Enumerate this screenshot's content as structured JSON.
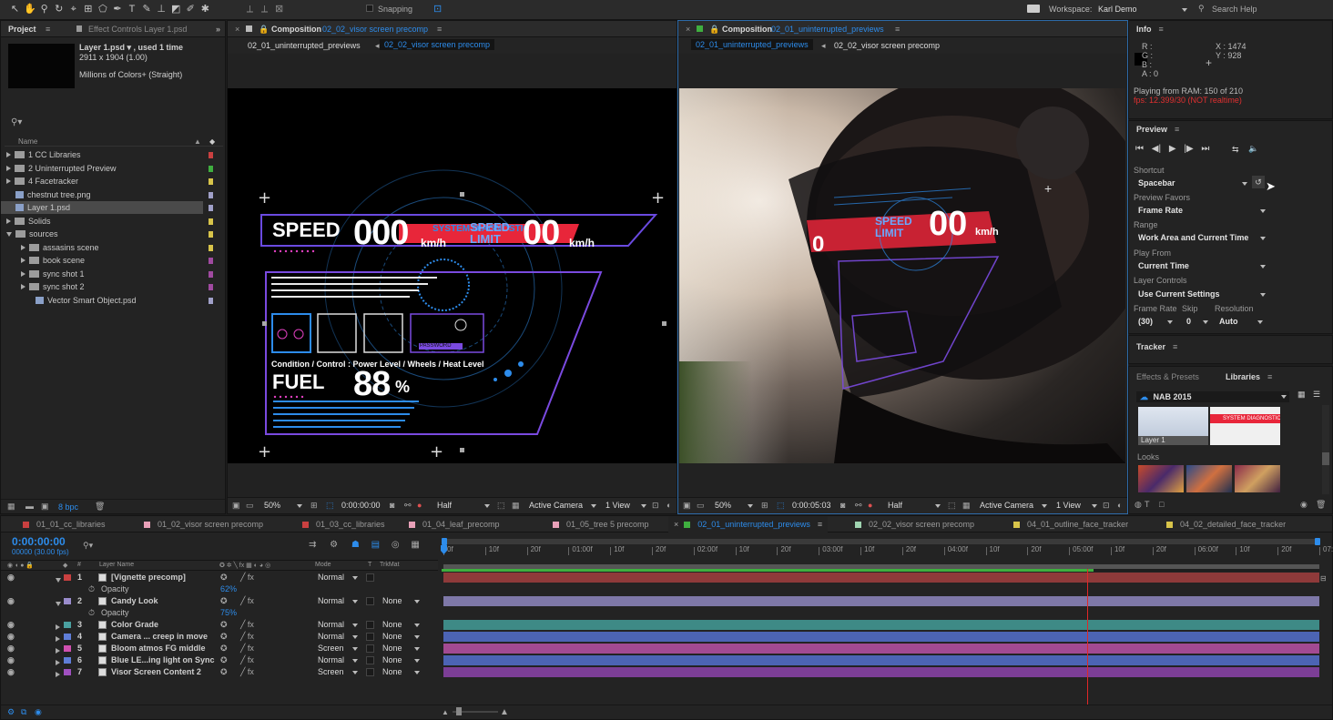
{
  "toolbar": {
    "snapping": "Snapping",
    "workspace_label": "Workspace:",
    "workspace": "Karl Demo",
    "search": "Search Help"
  },
  "project": {
    "title": "Project",
    "effects_tab": "Effect Controls Layer 1.psd",
    "file_name": "Layer 1.psd ▾ , used 1 time",
    "dims": "2911 x 1904 (1.00)",
    "colors": "Millions of Colors+ (Straight)",
    "name_col": "Name",
    "bpc": "8 bpc",
    "items": [
      {
        "name": "1 CC Libraries",
        "type": "folder",
        "color": "#c94040"
      },
      {
        "name": "2 Uninterrupted Preview",
        "type": "folder",
        "color": "#3fae3f"
      },
      {
        "name": "4 Facetracker",
        "type": "folder",
        "color": "#d8c44a"
      },
      {
        "name": "chestnut tree.png",
        "type": "file",
        "color": "#a0a0c8"
      },
      {
        "name": "Layer 1.psd",
        "type": "file",
        "color": "#a0a0c8"
      },
      {
        "name": "Solids",
        "type": "folder",
        "color": "#d8c44a"
      },
      {
        "name": "sources",
        "type": "folder-open",
        "color": "#d8c44a"
      },
      {
        "name": "assasins scene",
        "type": "subfolder",
        "color": "#d8c44a"
      },
      {
        "name": "book scene",
        "type": "subfolder",
        "color": "#a04aa0"
      },
      {
        "name": "sync shot 1",
        "type": "subfolder",
        "color": "#a04aa0"
      },
      {
        "name": "sync shot 2",
        "type": "subfolder",
        "color": "#a04aa0"
      },
      {
        "name": "Vector Smart Object.psd",
        "type": "file2",
        "color": "#a0a0c8"
      }
    ]
  },
  "comp1": {
    "title": "Composition",
    "name": "02_02_visor screen precomp",
    "bc1": "02_01_uninterrupted_previews",
    "bc2": "02_02_visor screen precomp",
    "zoom": "50%",
    "time": "0:00:00:00",
    "res": "Half",
    "camera": "Active Camera",
    "view": "1 View"
  },
  "comp2": {
    "title": "Composition",
    "name": "02_01_uninterrupted_previews",
    "bc1": "02_01_uninterrupted_previews",
    "bc2": "02_02_visor screen precomp",
    "zoom": "50%",
    "time": "0:00:05:03",
    "res": "Half",
    "camera": "Active Camera",
    "view": "1 View"
  },
  "hud": {
    "speed": "SPEED",
    "speed_val": "000",
    "kmh": "km/h",
    "limit": "SPEED\nLIMIT",
    "limit_val": "00",
    "cond": "Condition / Control : Power Level / Wheels / Heat Level",
    "fuel": "FUEL",
    "fuel_val": "88",
    "pct": "%",
    "diag": "SYSTEM DIAGNOSTIC",
    "pw": "PASSWORD"
  },
  "visor": {
    "limit": "SPEED LIMIT",
    "val": "00",
    "kmh": "km/h",
    "left": "0",
    "sub": "0 km/h"
  },
  "info": {
    "title": "Info",
    "r": "R :",
    "g": "G :",
    "b": "B :",
    "a": "A : 0",
    "x": "X : 1474",
    "y": "Y : 928",
    "ram": "Playing from RAM: 150 of 210",
    "fps": "fps: 12.399/30 (NOT realtime)"
  },
  "preview": {
    "title": "Preview",
    "shortcut_lbl": "Shortcut",
    "shortcut": "Spacebar",
    "favors_lbl": "Preview Favors",
    "favors": "Frame Rate",
    "range_lbl": "Range",
    "range": "Work Area and Current Time",
    "playfrom_lbl": "Play From",
    "playfrom": "Current Time",
    "layer_lbl": "Layer Controls",
    "layer": "Use Current Settings",
    "fr_lbl": "Frame Rate",
    "skip_lbl": "Skip",
    "res_lbl": "Resolution",
    "fr": "(30)",
    "skip": "0",
    "res": "Auto"
  },
  "tracker": {
    "title": "Tracker"
  },
  "libraries": {
    "tab1": "Effects & Presets",
    "tab2": "Libraries",
    "lib": "NAB 2015",
    "thumb1": "Layer 1",
    "looks": "Looks",
    "diag": "SYSTEM DIAGNOSTIC"
  },
  "timeline": {
    "tabs": [
      {
        "label": "01_01_cc_libraries",
        "color": "#c94040"
      },
      {
        "label": "01_02_visor screen precomp",
        "color": "#e8a0b8"
      },
      {
        "label": "01_03_cc_libraries",
        "color": "#c94040"
      },
      {
        "label": "01_04_leaf_precomp",
        "color": "#e8a0b8"
      },
      {
        "label": "01_05_tree 5 precomp",
        "color": "#e8a0b8"
      },
      {
        "label": "02_01_uninterrupted_previews",
        "color": "#3fae3f",
        "active": true
      },
      {
        "label": "02_02_visor screen precomp",
        "color": "#9fd4b0"
      },
      {
        "label": "04_01_outline_face_tracker",
        "color": "#d8c44a"
      },
      {
        "label": "04_02_detailed_face_tracker",
        "color": "#d8c44a"
      }
    ],
    "time": "0:00:00:00",
    "fps": "00000 (30.00 fps)",
    "col_num": "#",
    "col_name": "Layer Name",
    "col_mode": "Mode",
    "col_t": "T",
    "col_trk": "TrkMat",
    "ruler": [
      "0f",
      "10f",
      "20f",
      "01:00f",
      "10f",
      "20f",
      "02:00f",
      "10f",
      "20f",
      "03:00f",
      "10f",
      "20f",
      "04:00f",
      "10f",
      "20f",
      "05:00f",
      "10f",
      "20f",
      "06:00f",
      "10f",
      "20f",
      "07:0"
    ],
    "rows": [
      {
        "num": "1",
        "name": "[Vignette precomp]",
        "color": "#c94040",
        "mode": "Normal",
        "trk": "",
        "bar": "#8e3a3a",
        "expand": true
      },
      {
        "sub": "Opacity",
        "val": "62%"
      },
      {
        "num": "2",
        "name": "Candy Look",
        "color": "#9a8ccc",
        "mode": "Normal",
        "trk": "None",
        "bar": "#7e78a8",
        "expand": true
      },
      {
        "sub": "Opacity",
        "val": "75%"
      },
      {
        "num": "3",
        "name": "Color Grade",
        "color": "#4aa0a0",
        "mode": "Normal",
        "trk": "None",
        "bar": "#3e8a86"
      },
      {
        "num": "4",
        "name": "Camera ... creep in move",
        "color": "#5f7ed8",
        "mode": "Normal",
        "trk": "None",
        "bar": "#4c64b4"
      },
      {
        "num": "5",
        "name": "Bloom atmos FG middle",
        "color": "#d050b0",
        "mode": "Screen",
        "trk": "None",
        "bar": "#a24a92"
      },
      {
        "num": "6",
        "name": "Blue LE...ing light on Sync",
        "color": "#5f7ed8",
        "mode": "Normal",
        "trk": "None",
        "bar": "#4c64b4"
      },
      {
        "num": "7",
        "name": "Visor Screen Content 2",
        "color": "#a050c0",
        "mode": "Screen",
        "trk": "None",
        "bar": "#7c3e96"
      }
    ]
  }
}
